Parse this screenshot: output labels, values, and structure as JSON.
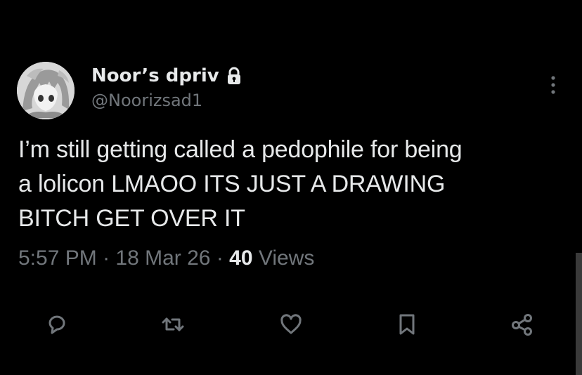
{
  "tweet": {
    "author": {
      "display_name": "Noor’s dpriv",
      "handle": "@Noorizsad1",
      "protected_icon": "lock-icon",
      "avatar_icon": "anime-avatar"
    },
    "text_lines": [
      "I’m still getting called a pedophile for being",
      "a lolicon LMAOO ITS JUST A DRAWING",
      "BITCH GET OVER IT"
    ],
    "meta": {
      "time": "5:57 PM",
      "separator": " · ",
      "date": "18 Mar 26",
      "views_count": "40",
      "views_label": " Views"
    },
    "actions": [
      {
        "name": "reply",
        "icon": "reply-icon"
      },
      {
        "name": "retweet",
        "icon": "retweet-icon"
      },
      {
        "name": "like",
        "icon": "heart-icon"
      },
      {
        "name": "bookmark",
        "icon": "bookmark-icon"
      },
      {
        "name": "share",
        "icon": "share-icon"
      }
    ],
    "more_icon": "more-vertical-icon"
  },
  "colors": {
    "background": "#000000",
    "primary_text": "#e7e9ea",
    "secondary_text": "#71767b",
    "icon": "#71767b"
  }
}
